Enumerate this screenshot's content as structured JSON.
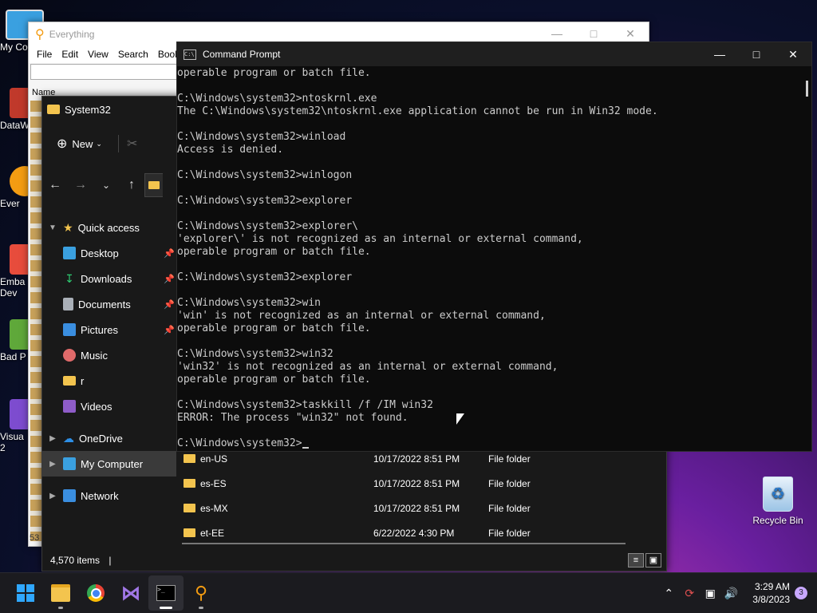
{
  "desktop": {
    "icons": [
      {
        "label": "My Co",
        "icon": "monitor-icon",
        "color": "#3aa0e0"
      },
      {
        "label": "DataW",
        "icon": "datawatch-icon",
        "color": "#c0392b"
      },
      {
        "label": "Ever",
        "icon": "everything-icon",
        "color": "#f39c12"
      },
      {
        "label": "Emba\nDev",
        "icon": "embarcadero-icon",
        "color": "#e74c3c"
      },
      {
        "label": "Bad P",
        "icon": "badpiggies-icon",
        "color": "#5fa83a"
      },
      {
        "label": "Visua\n2",
        "icon": "visual-studio-icon",
        "color": "#7d4ccf"
      }
    ],
    "recycle_bin": "Recycle Bin"
  },
  "everything": {
    "title": "Everything",
    "menu": [
      "File",
      "Edit",
      "View",
      "Search",
      "Book"
    ],
    "column_name": "Name",
    "count_fragment": "53"
  },
  "explorer": {
    "tab_title": "System32",
    "new_label": "New",
    "nav": {
      "quick_access": "Quick access",
      "pinned": [
        {
          "label": "Desktop",
          "icon": "desktop-icon",
          "color": "#3aa0e0"
        },
        {
          "label": "Downloads",
          "icon": "download-icon",
          "color": "#2ecc71"
        },
        {
          "label": "Documents",
          "icon": "documents-icon",
          "color": "#aab0b8"
        },
        {
          "label": "Pictures",
          "icon": "pictures-icon",
          "color": "#3a8ee0"
        }
      ],
      "others": [
        {
          "label": "Music",
          "icon": "music-icon",
          "color": "#e06a6a"
        },
        {
          "label": "r",
          "icon": "folder-icon",
          "color": "#f3c44e"
        },
        {
          "label": "Videos",
          "icon": "videos-icon",
          "color": "#8e5cc8"
        }
      ],
      "onedrive": "OneDrive",
      "my_computer": "My Computer",
      "network": "Network"
    },
    "rows": [
      {
        "name": "en-US",
        "date": "10/17/2022 8:51 PM",
        "type": "File folder"
      },
      {
        "name": "es-ES",
        "date": "10/17/2022 8:51 PM",
        "type": "File folder"
      },
      {
        "name": "es-MX",
        "date": "10/17/2022 8:51 PM",
        "type": "File folder"
      },
      {
        "name": "et-EE",
        "date": "6/22/2022 4:30 PM",
        "type": "File folder"
      }
    ],
    "status": "4,570 items"
  },
  "cmd": {
    "title": "Command Prompt",
    "lines": [
      "operable program or batch file.",
      "",
      "C:\\Windows\\system32>ntoskrnl.exe",
      "The C:\\Windows\\system32\\ntoskrnl.exe application cannot be run in Win32 mode.",
      "",
      "C:\\Windows\\system32>winload",
      "Access is denied.",
      "",
      "C:\\Windows\\system32>winlogon",
      "",
      "C:\\Windows\\system32>explorer",
      "",
      "C:\\Windows\\system32>explorer\\",
      "'explorer\\' is not recognized as an internal or external command,",
      "operable program or batch file.",
      "",
      "C:\\Windows\\system32>explorer",
      "",
      "C:\\Windows\\system32>win",
      "'win' is not recognized as an internal or external command,",
      "operable program or batch file.",
      "",
      "C:\\Windows\\system32>win32",
      "'win32' is not recognized as an internal or external command,",
      "operable program or batch file.",
      "",
      "C:\\Windows\\system32>taskkill /f /IM win32",
      "ERROR: The process \"win32\" not found.",
      ""
    ],
    "prompt": "C:\\Windows\\system32>"
  },
  "taskbar": {
    "apps": [
      {
        "icon": "windows-start-icon",
        "active": false
      },
      {
        "icon": "file-explorer-icon",
        "active": false
      },
      {
        "icon": "chrome-icon",
        "active": false
      },
      {
        "icon": "visual-studio-icon",
        "active": false
      },
      {
        "icon": "terminal-icon",
        "active": true
      },
      {
        "icon": "everything-search-icon",
        "active": false
      }
    ],
    "time": "3:29 AM",
    "date": "3/8/2023",
    "notifications": "3"
  },
  "colors": {
    "accent": "#0078d4",
    "folder": "#f3c44e",
    "console_text": "#cccccc"
  }
}
